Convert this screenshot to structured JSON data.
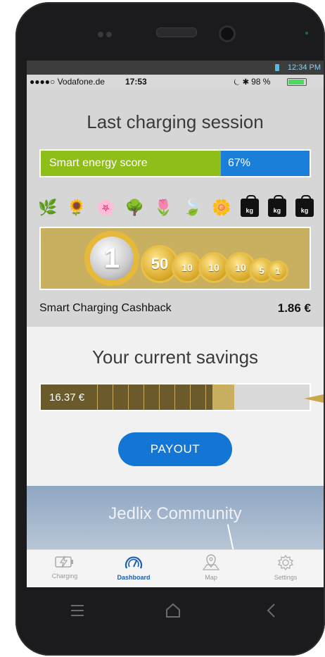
{
  "android_status": {
    "time": "12:34 PM"
  },
  "ios_status": {
    "carrier": "●●●●○ Vodafone.de",
    "time": "17:53",
    "battery": "98 %"
  },
  "last_session": {
    "title": "Last charging session",
    "score_label": "Smart energy score",
    "score_value": "67%",
    "score_fraction": 0.67,
    "impact_icons": [
      "plant-icon",
      "sunflower-icon",
      "blossom-icon",
      "tree-icon",
      "tulip-icon",
      "leaves-icon",
      "flower-icon",
      "kg-weight-icon",
      "kg-weight-icon",
      "kg-weight-icon"
    ],
    "weight_label": "kg",
    "coins": [
      "1",
      "50",
      "10",
      "10",
      "10",
      "5",
      "1"
    ],
    "cashback_label": "Smart Charging Cashback",
    "cashback_value": "1.86 €"
  },
  "savings": {
    "title": "Your current savings",
    "amount": "16.37 €",
    "fill_fraction": 0.72,
    "payout_label": "PAYOUT"
  },
  "community": {
    "title": "Jedlix Community"
  },
  "tabs": [
    {
      "label": "Charging",
      "icon": "lightning-icon"
    },
    {
      "label": "Dashboard",
      "icon": "gauge-icon"
    },
    {
      "label": "Map",
      "icon": "map-pin-icon"
    },
    {
      "label": "Settings",
      "icon": "gear-icon"
    }
  ],
  "colors": {
    "green": "#8fbd1a",
    "blue": "#1a7fd9",
    "gold": "#c8b060",
    "payout": "#1476d4"
  }
}
